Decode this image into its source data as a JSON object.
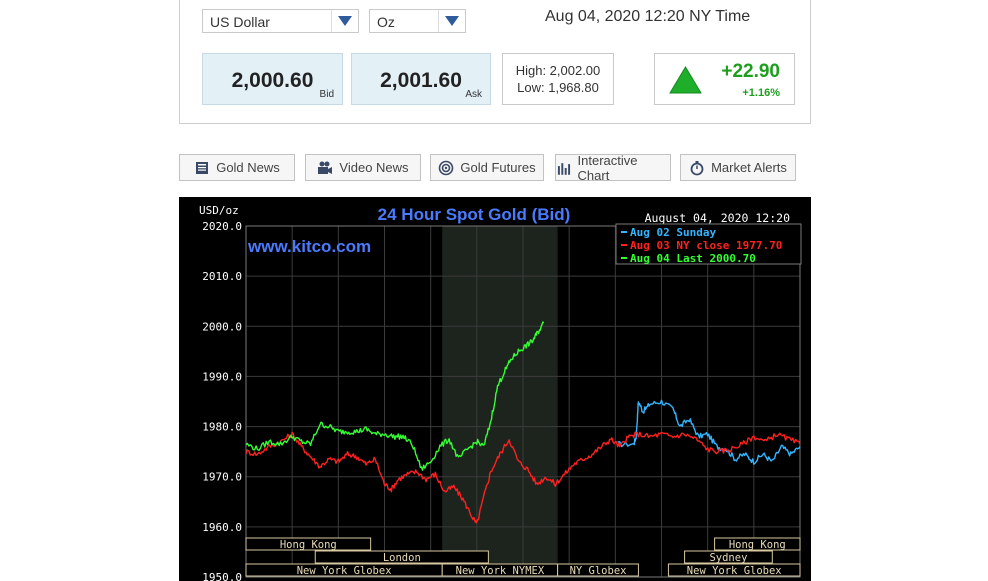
{
  "selectors": {
    "currency": "US Dollar",
    "unit": "Oz"
  },
  "timestamp": "Aug 04, 2020 12:20 NY Time",
  "quote": {
    "bid": "2,000.60",
    "bid_label": "Bid",
    "ask": "2,001.60",
    "ask_label": "Ask",
    "high": "High: 2,002.00",
    "low": "Low: 1,968.80",
    "change": "+22.90",
    "change_pct": "+1.16%"
  },
  "nav": [
    {
      "label": "Gold News",
      "icon": "newspaper-icon"
    },
    {
      "label": "Video News",
      "icon": "video-camera-icon"
    },
    {
      "label": "Gold Futures",
      "icon": "target-icon"
    },
    {
      "label": "Interactive Chart",
      "icon": "bar-chart-icon"
    },
    {
      "label": "Market Alerts",
      "icon": "stopwatch-icon"
    }
  ],
  "colors": {
    "up": "#1e9e1e",
    "pricebox": "#e3f0f6",
    "chart_title": "#4a7bff",
    "series_sunday": "#33b5ff",
    "series_close": "#ff2020",
    "series_last": "#33ff33"
  },
  "chart_data": {
    "type": "line",
    "title": "24 Hour Spot Gold (Bid)",
    "ylabel": "USD/oz",
    "watermark": "www.kitco.com",
    "date_label": "August 04, 2020 12:20",
    "ylim": [
      1950,
      2020
    ],
    "yticks": [
      "2020.0",
      "2010.0",
      "2000.0",
      "1990.0",
      "1980.0",
      "1970.0",
      "1960.0",
      "1950.0"
    ],
    "yticks_values": [
      2020,
      2010,
      2000,
      1990,
      1980,
      1970,
      1960,
      1950
    ],
    "x_hours_range": [
      0,
      24
    ],
    "highlight_hours": [
      8.5,
      13.5
    ],
    "grid": true,
    "legend_placement": "top-right",
    "legend": [
      "Aug 02 Sunday",
      "Aug 03 NY close 1977.70",
      "Aug 04 Last 2000.70"
    ],
    "series": [
      {
        "name": "Aug 02 Sunday",
        "x": [
          16.1,
          16.8,
          16.9,
          17.0,
          17.2,
          17.5,
          18.0,
          18.5,
          18.8,
          19.2,
          19.6,
          20.0,
          20.4,
          20.8,
          21.2,
          21.6,
          22.0,
          22.4,
          22.8,
          23.2,
          23.6,
          24.0
        ],
        "y": [
          1976.5,
          1976.5,
          1978.0,
          1985.0,
          1983.0,
          1984.5,
          1985.0,
          1983.5,
          1980.0,
          1981.5,
          1978.0,
          1978.5,
          1976.0,
          1975.5,
          1973.5,
          1974.5,
          1973.0,
          1974.5,
          1973.0,
          1976.0,
          1974.5,
          1976.0
        ]
      },
      {
        "name": "Aug 03 NY close 1977.70",
        "x": [
          0,
          0.5,
          1.0,
          1.5,
          2.0,
          2.4,
          2.8,
          3.2,
          3.6,
          4.0,
          4.4,
          4.8,
          5.2,
          5.6,
          6.0,
          6.3,
          6.6,
          7.0,
          7.4,
          7.8,
          8.2,
          8.6,
          9.0,
          9.4,
          9.8,
          10.0,
          10.3,
          10.6,
          11.0,
          11.4,
          11.8,
          12.2,
          12.6,
          13.0,
          13.4,
          13.8,
          14.2,
          14.6,
          15.0,
          15.4,
          15.8,
          16.2,
          16.6,
          17.0,
          17.5,
          18.0,
          18.5,
          19.0,
          19.5,
          20.0,
          20.5,
          21.0,
          21.5,
          22.0,
          22.5,
          23.0,
          23.5,
          24.0
        ],
        "y": [
          1975.0,
          1974.5,
          1976.0,
          1977.0,
          1978.5,
          1976.0,
          1974.0,
          1972.0,
          1973.5,
          1973.0,
          1974.5,
          1974.0,
          1972.5,
          1973.5,
          1968.5,
          1967.5,
          1969.5,
          1970.5,
          1971.0,
          1969.5,
          1970.5,
          1967.0,
          1968.0,
          1965.5,
          1962.0,
          1960.5,
          1966.0,
          1971.0,
          1974.5,
          1977.5,
          1973.0,
          1971.5,
          1968.5,
          1970.0,
          1968.5,
          1970.5,
          1972.5,
          1973.5,
          1974.5,
          1976.0,
          1977.5,
          1976.0,
          1978.0,
          1978.5,
          1978.0,
          1978.5,
          1978.0,
          1978.5,
          1977.5,
          1975.5,
          1975.0,
          1975.5,
          1976.5,
          1978.0,
          1977.0,
          1978.5,
          1977.5,
          1976.5
        ]
      },
      {
        "name": "Aug 04 Last 2000.70",
        "x": [
          0,
          0.5,
          1.0,
          1.5,
          2.0,
          2.4,
          2.8,
          3.2,
          3.6,
          4.0,
          4.4,
          4.8,
          5.2,
          5.6,
          6.0,
          6.4,
          6.8,
          7.2,
          7.6,
          8.0,
          8.4,
          8.8,
          9.2,
          9.6,
          10.0,
          10.3,
          10.6,
          10.9,
          11.2,
          11.5,
          11.8,
          12.1,
          12.4,
          12.6,
          12.9
        ],
        "y": [
          1976.5,
          1975.5,
          1977.0,
          1976.5,
          1978.0,
          1977.0,
          1976.5,
          1980.5,
          1980.0,
          1979.0,
          1979.0,
          1979.0,
          1979.5,
          1978.5,
          1978.5,
          1978.0,
          1978.0,
          1976.5,
          1971.5,
          1973.0,
          1976.0,
          1977.5,
          1973.5,
          1975.5,
          1977.0,
          1976.0,
          1981.0,
          1988.0,
          1991.0,
          1993.5,
          1995.0,
          1996.0,
          1997.0,
          1998.5,
          2000.7
        ]
      }
    ],
    "session_rows": [
      [
        {
          "label": "Hong Kong",
          "from": 0,
          "to": 5.4
        },
        {
          "label": "Hong Kong",
          "from": 20.3,
          "to": 24.0
        }
      ],
      [
        {
          "label": "London",
          "from": 3.0,
          "to": 10.5
        },
        {
          "label": "Sydney",
          "from": 19.0,
          "to": 22.8
        }
      ],
      [
        {
          "label": "New York Globex",
          "from": 0,
          "to": 8.5
        },
        {
          "label": "New York NYMEX",
          "from": 8.5,
          "to": 13.5
        },
        {
          "label": "NY Globex",
          "from": 13.5,
          "to": 17.0
        },
        {
          "label": "New York Globex",
          "from": 18.3,
          "to": 24.0
        }
      ]
    ]
  }
}
